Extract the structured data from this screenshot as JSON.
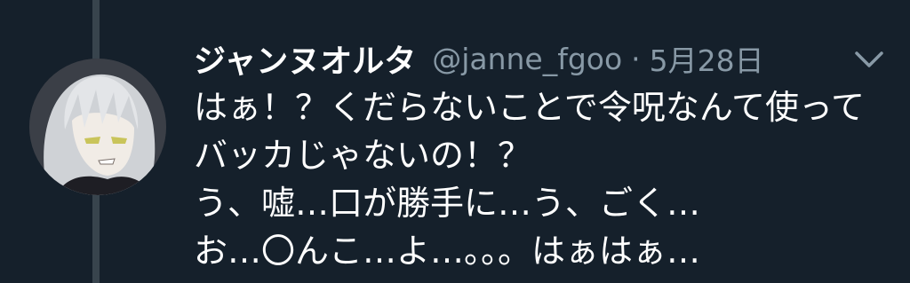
{
  "tweet": {
    "display_name": "ジャンヌオルタ",
    "handle": "@janne_fgoo",
    "separator": "·",
    "date": "5月28日",
    "lines": [
      "はぁ！？くだらないことで令呪なんて使って",
      "バッカじゃないの！？",
      "う、嘘…口が勝手に…う、ごく…",
      "お…〇んこ…よ…。。。はぁはぁ…"
    ]
  },
  "icons": {
    "avatar": "profile-avatar",
    "menu": "chevron-down-icon"
  },
  "colors": {
    "background": "#15202b",
    "thread_line": "#38444d",
    "text": "#ffffff",
    "secondary_text": "#8899a6"
  }
}
